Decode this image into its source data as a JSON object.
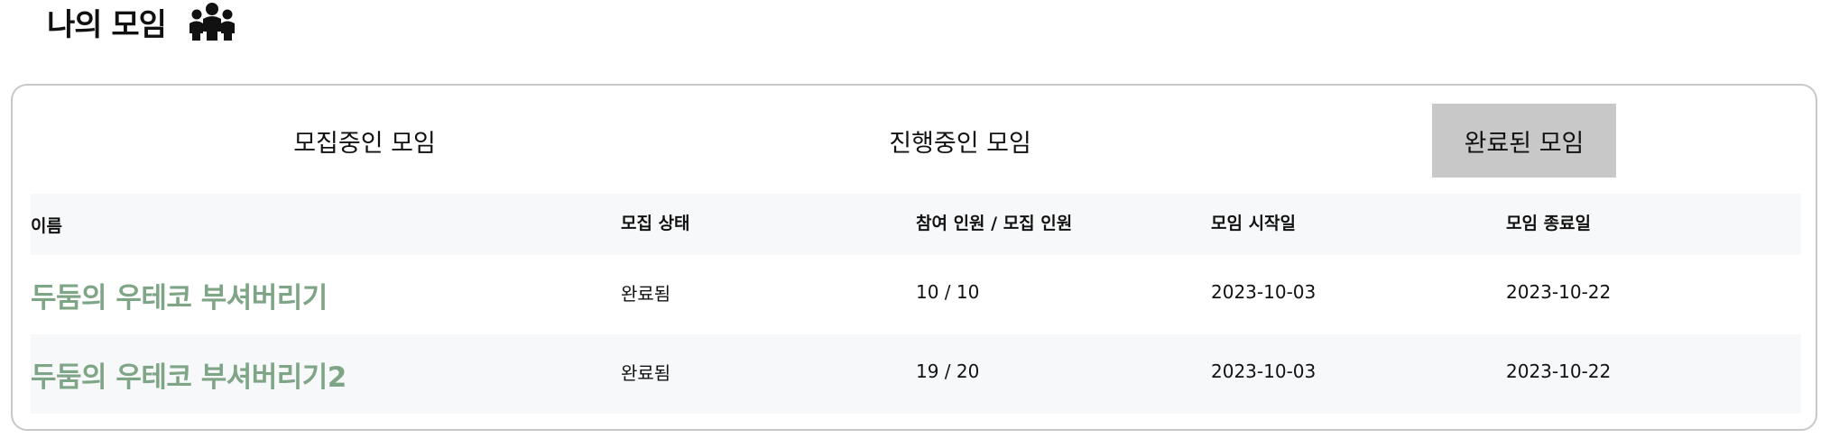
{
  "header": {
    "title": "나의 모임",
    "icon": "people-group-icon"
  },
  "tabs": [
    {
      "label": "모집중인 모임",
      "active": false
    },
    {
      "label": "진행중인 모임",
      "active": false
    },
    {
      "label": "완료된 모임",
      "active": true
    }
  ],
  "table": {
    "columns": [
      "이름",
      "모집 상태",
      "참여 인원 / 모집 인원",
      "모임 시작일",
      "모임 종료일"
    ],
    "rows": [
      {
        "name": "두둠의 우테코 부셔버리기",
        "status": "완료됨",
        "members": "10 / 10",
        "start": "2023-10-03",
        "end": "2023-10-22"
      },
      {
        "name": "두둠의 우테코 부셔버리기2",
        "status": "완료됨",
        "members": "19 / 20",
        "start": "2023-10-03",
        "end": "2023-10-22"
      }
    ]
  },
  "colors": {
    "name_link": "#7fa587",
    "active_tab_bg": "#c8c8c8",
    "row_shade": "#f7f8f9",
    "panel_border": "#c8c8c8"
  }
}
